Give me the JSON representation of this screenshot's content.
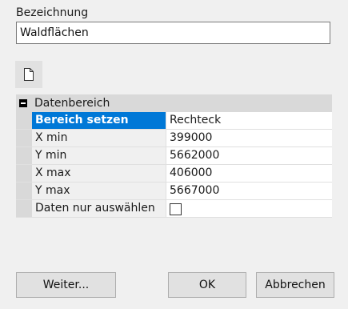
{
  "name_field": {
    "label": "Bezeichnung",
    "value": "Waldflächen"
  },
  "toolbar": {
    "new_icon": "blank-document-icon"
  },
  "property_grid": {
    "category": {
      "title": "Datenbereich",
      "expanded": true
    },
    "rows": [
      {
        "name": "Bereich setzen",
        "value": "Rechteck",
        "selected": true
      },
      {
        "name": "X min",
        "value": "399000"
      },
      {
        "name": "Y min",
        "value": "5662000"
      },
      {
        "name": "X max",
        "value": "406000"
      },
      {
        "name": "Y max",
        "value": "5667000"
      },
      {
        "name": "Daten nur auswählen",
        "checked": false
      }
    ]
  },
  "buttons": {
    "weiter": "Weiter...",
    "ok": "OK",
    "abbrechen": "Abbrechen"
  },
  "colors": {
    "selection": "#0078d7",
    "dialog_bg": "#f0f0f0",
    "category_bg": "#d9d9d9"
  }
}
